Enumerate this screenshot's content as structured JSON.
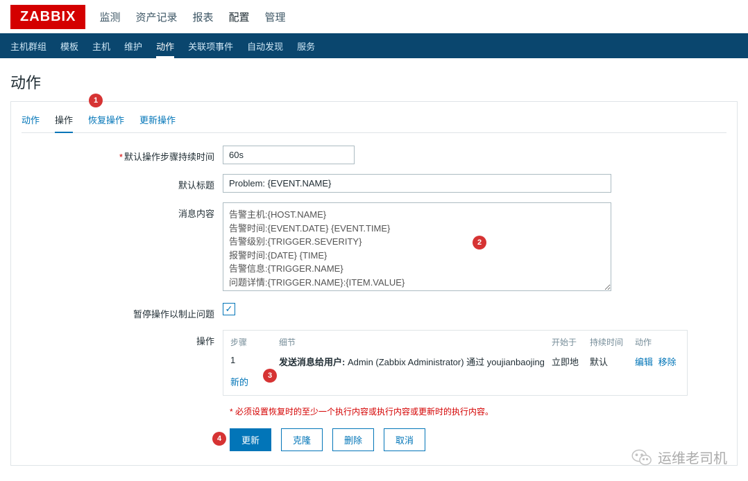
{
  "logo": "ZABBIX",
  "topNav": {
    "items": [
      "监测",
      "资产记录",
      "报表",
      "配置",
      "管理"
    ],
    "activeIndex": 3
  },
  "subNav": {
    "items": [
      "主机群组",
      "模板",
      "主机",
      "维护",
      "动作",
      "关联项事件",
      "自动发现",
      "服务"
    ],
    "activeIndex": 4
  },
  "pageTitle": "动作",
  "tabs": {
    "items": [
      "动作",
      "操作",
      "恢复操作",
      "更新操作"
    ],
    "activeIndex": 1
  },
  "form": {
    "durationLabel": "默认操作步骤持续时间",
    "durationValue": "60s",
    "titleLabel": "默认标题",
    "titleValue": "Problem: {EVENT.NAME}",
    "messageLabel": "消息内容",
    "messageValue": "告警主机:{HOST.NAME}\n告警时间:{EVENT.DATE} {EVENT.TIME}\n告警级别:{TRIGGER.SEVERITY}\n报警时间:{DATE} {TIME}\n告警信息:{TRIGGER.NAME}\n问题详情:{TRIGGER.NAME}:{ITEM.VALUE}",
    "pauseLabel": "暂停操作以制止问题",
    "opsLabel": "操作",
    "newLink": "新的"
  },
  "opsTable": {
    "headers": {
      "step": "步骤",
      "detail": "细节",
      "start": "开始于",
      "duration": "持续时间",
      "action": "动作"
    },
    "rows": [
      {
        "step": "1",
        "boldPrefix": "发送消息给用户:",
        "detail": " Admin (Zabbix Administrator) 通过 youjianbaojing",
        "start": "立即地",
        "duration": "默认",
        "editLabel": "编辑",
        "removeLabel": "移除"
      }
    ]
  },
  "note": "必须设置恢复时的至少一个执行内容或执行内容或更新时的执行内容。",
  "buttons": {
    "update": "更新",
    "clone": "克隆",
    "delete": "删除",
    "cancel": "取消"
  },
  "badges": [
    "1",
    "2",
    "3",
    "4"
  ],
  "watermark": "运维老司机"
}
